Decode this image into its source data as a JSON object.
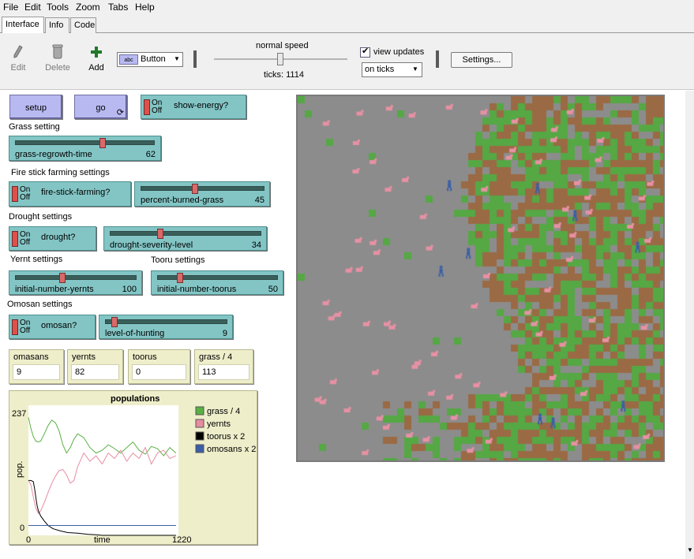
{
  "menubar": [
    "File",
    "Edit",
    "Tools",
    "Zoom",
    "Tabs",
    "Help"
  ],
  "tabs": [
    "Interface",
    "Info",
    "Code"
  ],
  "toolbar": {
    "edit": "Edit",
    "delete": "Delete",
    "add": "Add",
    "widget_type": "Button",
    "speed_label": "normal speed",
    "ticks_label": "ticks: 1114",
    "view_updates_label": "view updates",
    "update_mode": "on ticks",
    "settings": "Settings..."
  },
  "buttons": {
    "setup": "setup",
    "go": "go"
  },
  "switches": {
    "show_energy": {
      "label": "show-energy?",
      "on": "On",
      "off": "Off"
    },
    "fire_stick": {
      "label": "fire-stick-farming?",
      "on": "On",
      "off": "Off"
    },
    "drought": {
      "label": "drought?",
      "on": "On",
      "off": "Off"
    },
    "omosan": {
      "label": "omosan?",
      "on": "On",
      "off": "Off"
    }
  },
  "sections": {
    "grass": "Grass setting",
    "fire": "Fire stick farming settings",
    "drought": "Drought settings",
    "yernt": "Yernt settings",
    "tooru": "Tooru settings",
    "omosan": "Omosan settings"
  },
  "sliders": {
    "grass_regrowth": {
      "name": "grass-regrowth-time",
      "value": "62",
      "fraction": 0.62
    },
    "percent_burned": {
      "name": "percent-burned-grass",
      "value": "45",
      "fraction": 0.45
    },
    "drought_severity": {
      "name": "drought-severity-level",
      "value": "34",
      "fraction": 0.34
    },
    "initial_yernts": {
      "name": "initial-number-yernts",
      "value": "100",
      "fraction": 0.33
    },
    "initial_toorus": {
      "name": "initial-number-toorus",
      "value": "50",
      "fraction": 0.17
    },
    "hunting": {
      "name": "level-of-hunting",
      "value": "9",
      "fraction": 0.09
    }
  },
  "monitors": [
    {
      "label": "omasans",
      "value": "9"
    },
    {
      "label": "yernts",
      "value": "82"
    },
    {
      "label": "toorus",
      "value": "0"
    },
    {
      "label": "grass / 4",
      "value": "113"
    }
  ],
  "chart_data": {
    "type": "line",
    "title": "populations",
    "xlabel": "time",
    "ylabel": "pop.",
    "xlim": [
      0,
      1220
    ],
    "ylim": [
      0,
      237
    ],
    "x_tick_labels": [
      "0",
      "1220"
    ],
    "y_tick_labels": [
      "0",
      "237"
    ],
    "legend_position": "right",
    "series": [
      {
        "name": "grass / 4",
        "color": "#59b043",
        "x": [
          0,
          20,
          40,
          60,
          80,
          100,
          130,
          160,
          190,
          220,
          250,
          280,
          310,
          340,
          370,
          400,
          450,
          500,
          550,
          600,
          650,
          700,
          750,
          800,
          850,
          900,
          950,
          1000,
          1050,
          1100,
          1150,
          1200
        ],
        "y": [
          215,
          195,
          180,
          172,
          170,
          172,
          185,
          200,
          210,
          205,
          190,
          165,
          150,
          160,
          175,
          185,
          178,
          160,
          150,
          155,
          165,
          158,
          150,
          160,
          170,
          155,
          148,
          162,
          158,
          145,
          160,
          150
        ]
      },
      {
        "name": "yernts",
        "color": "#e88ca1",
        "x": [
          0,
          20,
          40,
          60,
          80,
          100,
          130,
          160,
          190,
          220,
          250,
          280,
          310,
          340,
          370,
          400,
          450,
          500,
          550,
          600,
          650,
          700,
          750,
          800,
          850,
          900,
          950,
          1000,
          1050,
          1100,
          1150,
          1200
        ],
        "y": [
          100,
          92,
          70,
          50,
          40,
          45,
          60,
          78,
          95,
          108,
          118,
          120,
          110,
          95,
          100,
          125,
          150,
          135,
          145,
          130,
          150,
          140,
          155,
          135,
          150,
          140,
          160,
          130,
          150,
          155,
          140,
          145
        ]
      },
      {
        "name": "toorus x 2",
        "color": "#000000",
        "x": [
          0,
          20,
          40,
          50,
          60,
          70,
          80,
          100,
          130,
          160,
          200,
          260,
          320,
          400,
          480,
          550,
          600,
          700,
          800,
          900,
          1000,
          1100,
          1200
        ],
        "y": [
          100,
          100,
          98,
          85,
          70,
          55,
          45,
          35,
          26,
          18,
          12,
          8,
          5,
          4,
          2,
          1,
          0,
          0,
          0,
          0,
          0,
          0,
          0
        ]
      },
      {
        "name": "omosans x 2",
        "color": "#3a5fa8",
        "x": [
          0,
          1200
        ],
        "y": [
          18,
          18
        ]
      }
    ]
  }
}
